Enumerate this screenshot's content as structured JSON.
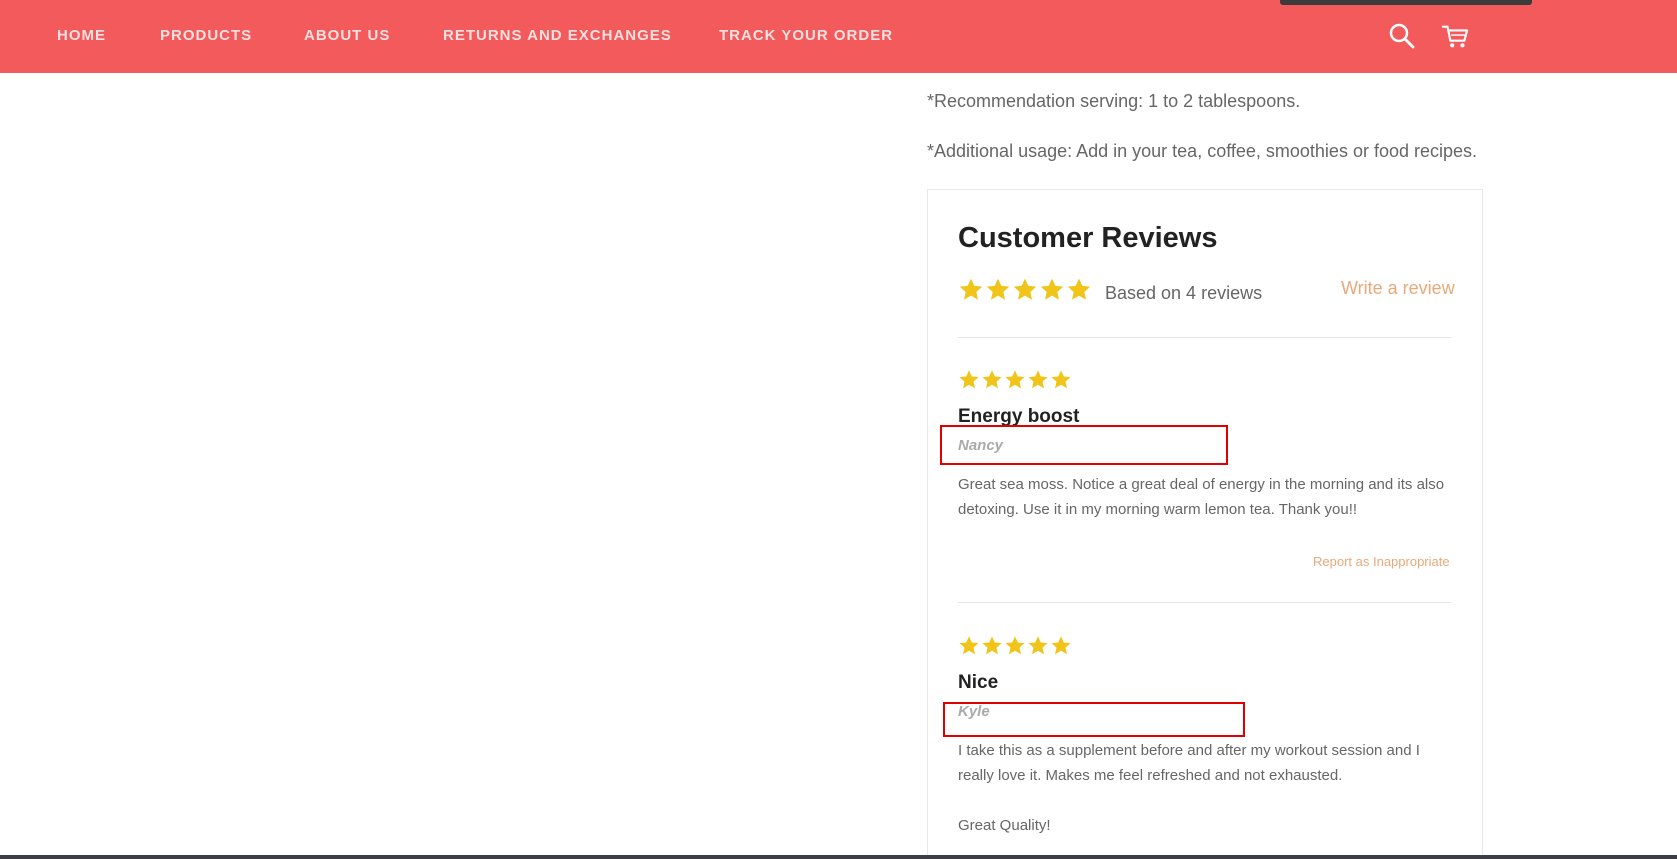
{
  "nav": {
    "items": [
      "HOME",
      "PRODUCTS",
      "ABOUT US",
      "RETURNS AND EXCHANGES",
      "TRACK YOUR ORDER"
    ],
    "icons": [
      "search-icon",
      "cart-icon"
    ]
  },
  "product": {
    "serving_text": "*Recommendation serving: 1 to 2 tablespoons.",
    "usage_text": "*Additional usage: Add in your tea, coffee, smoothies or food recipes."
  },
  "reviews": {
    "title": "Customer Reviews",
    "average_rating": 5,
    "max_rating": 5,
    "based_on": "Based on 4 reviews",
    "write_review": "Write a review",
    "items": [
      {
        "rating": 5,
        "title": "Energy boost",
        "author": "Nancy",
        "body": "Great sea moss. Notice a great deal of energy in the morning and its also detoxing. Use it in my morning warm lemon tea. Thank you!!",
        "report": "Report as Inappropriate"
      },
      {
        "rating": 5,
        "title": "Nice",
        "author": "Kyle",
        "body": "I take this as a supplement before and after my workout session and I really love it. Makes me feel refreshed and not exhausted.",
        "body_extra": "Great Quality!"
      }
    ]
  },
  "colors": {
    "nav_bg": "#f25a5b",
    "star": "#f0c419",
    "link": "#e9a979",
    "highlight": "#e00000"
  }
}
